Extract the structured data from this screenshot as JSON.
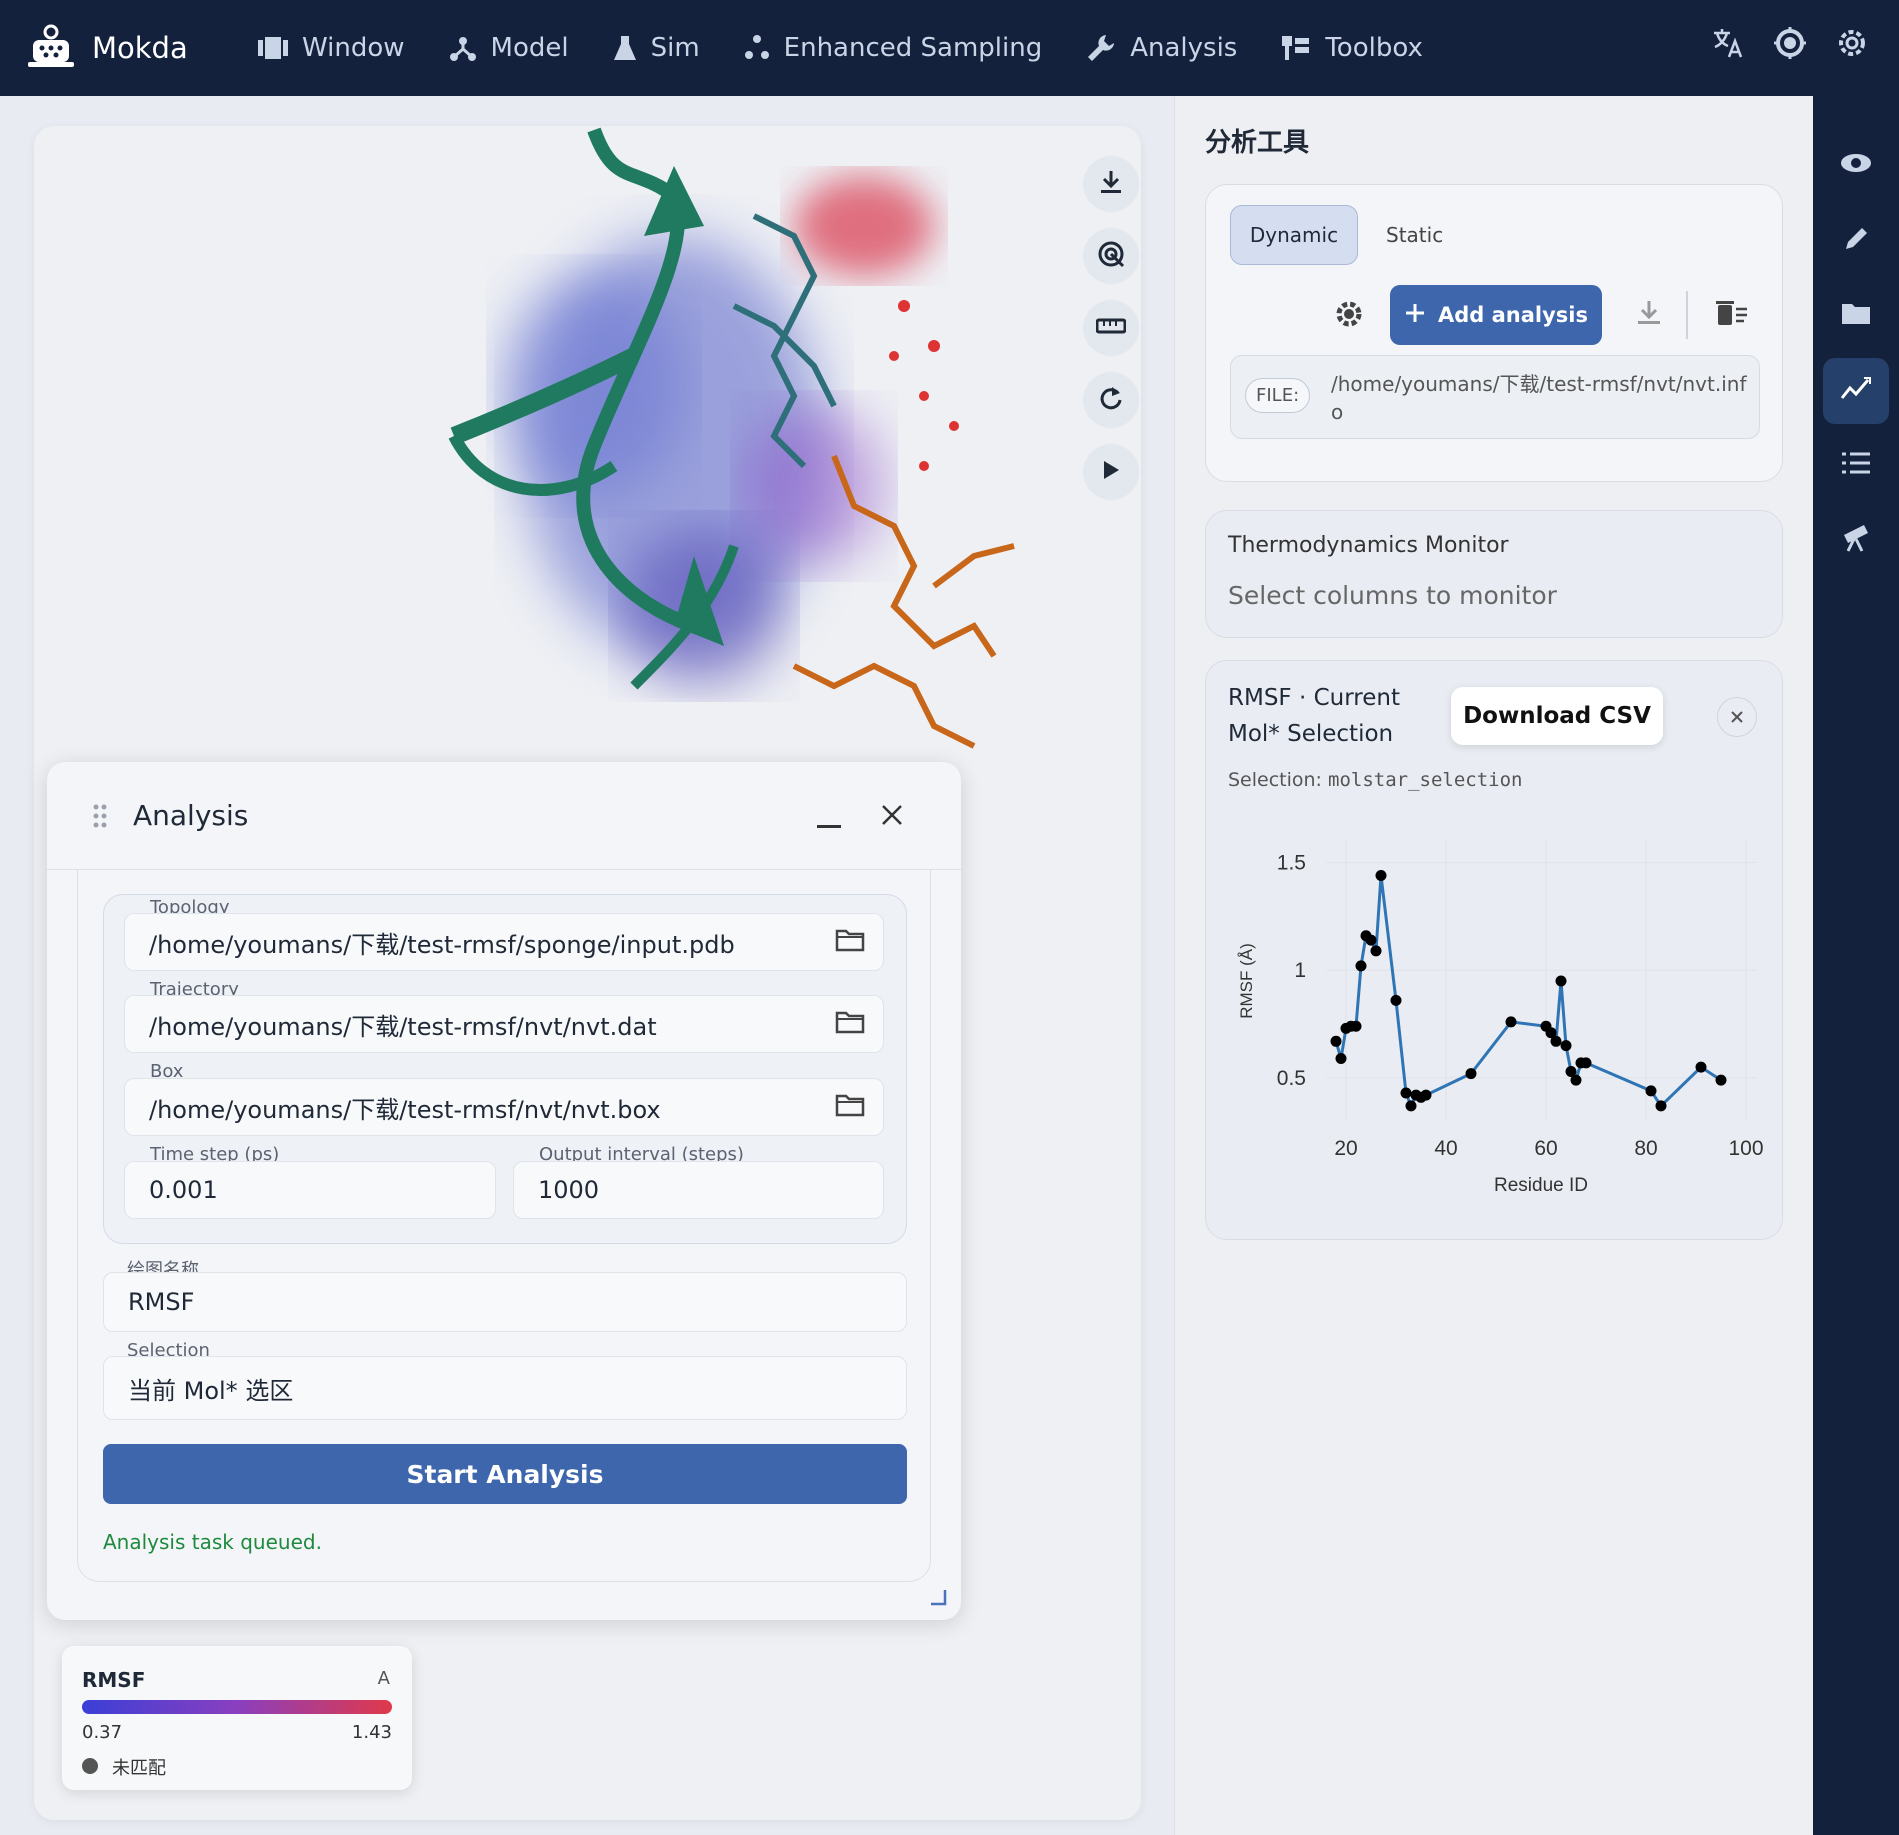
{
  "app": {
    "name": "Mokda"
  },
  "menu": [
    {
      "label": "Window",
      "icon": "window-icon"
    },
    {
      "label": "Model",
      "icon": "model-icon"
    },
    {
      "label": "Sim",
      "icon": "flask-icon"
    },
    {
      "label": "Enhanced Sampling",
      "icon": "sampling-icon"
    },
    {
      "label": "Analysis",
      "icon": "wrench-icon"
    },
    {
      "label": "Toolbox",
      "icon": "toolbox-icon"
    }
  ],
  "top_icons": [
    "translate-icon",
    "theme-icon",
    "settings-icon"
  ],
  "rail_icons": [
    "eye-icon",
    "pencil-icon",
    "folder-icon",
    "analysis-chart-icon",
    "list-icon",
    "telescope-icon"
  ],
  "rail_active": "analysis-chart-icon",
  "viewer_tools": [
    "download-icon",
    "select-target-icon",
    "ruler-icon",
    "reset-rotate-icon",
    "play-icon"
  ],
  "analysis_panel": {
    "title": "Analysis",
    "topology_label": "Topology",
    "topology_value": "/home/youmans/下载/test-rmsf/sponge/input.pdb",
    "trajectory_label": "Trajectory",
    "trajectory_value": "/home/youmans/下载/test-rmsf/nvt/nvt.dat",
    "box_label": "Box",
    "box_value": "/home/youmans/下载/test-rmsf/nvt/nvt.box",
    "timestep_label": "Time step (ps)",
    "timestep_value": "0.001",
    "interval_label": "Output interval (steps)",
    "interval_value": "1000",
    "plotname_label": "绘图名称",
    "plotname_value": "RMSF",
    "selection_label": "Selection",
    "selection_value": "当前 Mol* 选区",
    "start_button": "Start Analysis",
    "status": "Analysis task queued."
  },
  "color_legend": {
    "title": "RMSF",
    "unit": "A",
    "min": "0.37",
    "max": "1.43",
    "unmatched": "未匹配",
    "gradient": [
      "#3b3fd6",
      "#8a3fbf",
      "#e0394a"
    ]
  },
  "side": {
    "title": "分析工具",
    "tab_dynamic": "Dynamic",
    "tab_static": "Static",
    "active_tab": "Dynamic",
    "add_button": "Add analysis",
    "file_label": "FILE:",
    "file_value_line1": "/home/youmans/下载/test-rmsf/nvt/nvt.inf",
    "file_value_line2": "o",
    "thermo_title": "Thermodynamics Monitor",
    "thermo_placeholder": "Select columns to monitor",
    "result_title_line1": "RMSF · Current",
    "result_title_line2": "Mol* Selection",
    "download_csv": "Download CSV",
    "selection_prefix": "Selection:",
    "selection_code": "molstar_selection"
  },
  "colors": {
    "accent": "#3d66ad",
    "topbar": "#14213d",
    "success": "#1e8a3e",
    "line": "#2f75b5"
  },
  "chart_data": {
    "type": "line",
    "title": "",
    "xlabel": "Residue ID",
    "ylabel": "RMSF (Å)",
    "xlim": [
      16,
      102
    ],
    "ylim": [
      0.3,
      1.6
    ],
    "xticks": [
      20,
      40,
      60,
      80,
      100
    ],
    "yticks": [
      0.5,
      1,
      1.5
    ],
    "yticklabels": [
      "0.5",
      "1",
      "1.5"
    ],
    "grid": true,
    "series": [
      {
        "x": [
          18,
          19,
          20,
          21,
          22,
          23,
          24,
          25,
          26,
          27,
          30,
          32,
          33,
          34,
          35,
          36,
          45,
          53,
          60,
          61,
          62,
          63,
          64,
          65,
          66,
          67,
          68,
          81,
          83,
          91,
          95
        ],
        "y": [
          0.67,
          0.59,
          0.73,
          0.74,
          0.74,
          1.02,
          1.16,
          1.14,
          1.09,
          1.44,
          0.86,
          0.43,
          0.37,
          0.42,
          0.41,
          0.42,
          0.52,
          0.76,
          0.74,
          0.71,
          0.67,
          0.95,
          0.65,
          0.53,
          0.49,
          0.57,
          0.57,
          0.44,
          0.37,
          0.55,
          0.49
        ]
      }
    ]
  }
}
